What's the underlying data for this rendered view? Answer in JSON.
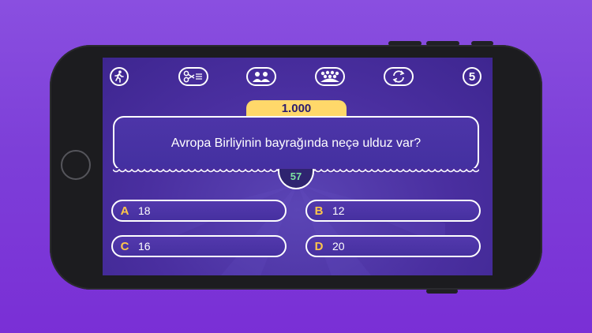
{
  "toolbar": {
    "walk_away_icon": "walk-away-icon",
    "fifty_fifty_icon": "fifty-fifty-icon",
    "phone_friend_icon": "phone-friend-icon",
    "ask_audience_icon": "ask-audience-icon",
    "switch_question_icon": "switch-question-icon",
    "level_badge": "5"
  },
  "prize": "1.000",
  "question": "Avropa Birliyinin bayrağında neçə ulduz var?",
  "timer": "57",
  "answers": [
    {
      "letter": "A",
      "text": "18"
    },
    {
      "letter": "B",
      "text": "12"
    },
    {
      "letter": "C",
      "text": "16"
    },
    {
      "letter": "D",
      "text": "20"
    }
  ],
  "colors": {
    "background": "#7d3fd8",
    "screen": "#4a2fa0",
    "prize_banner": "#ffd86a",
    "answer_letter": "#ffc64a",
    "timer_text": "#7de2a2"
  }
}
